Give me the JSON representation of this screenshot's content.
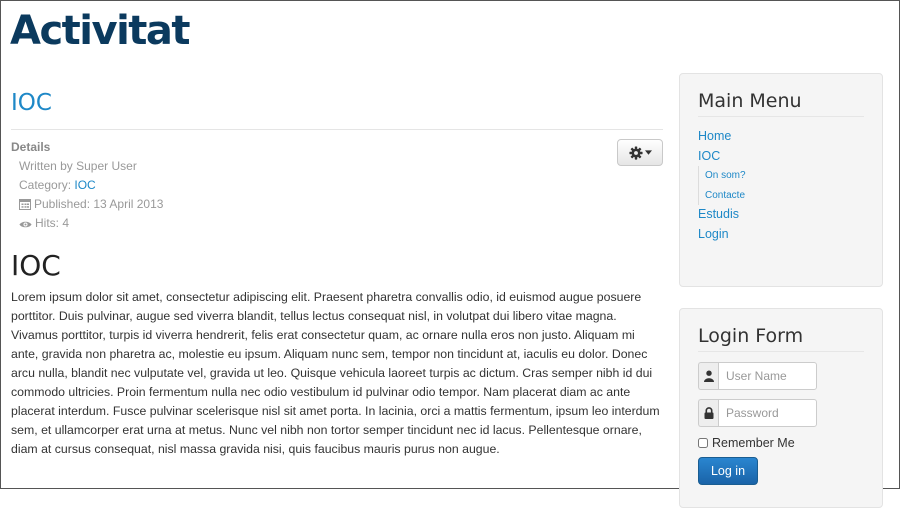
{
  "site": {
    "title": "Activitat"
  },
  "article": {
    "title": "IOC",
    "details": {
      "heading": "Details",
      "written_by": "Written by Super User",
      "category_label": "Category: ",
      "category_link": "IOC",
      "published": "Published: 13 April 2013",
      "hits": "Hits: 4"
    },
    "tools_icon": "gear-icon",
    "body_heading": "IOC",
    "body_text": "Lorem ipsum dolor sit amet, consectetur adipiscing elit. Praesent pharetra convallis odio, id euismod augue posuere porttitor. Duis pulvinar, augue sed viverra blandit, tellus lectus consequat nisl, in volutpat dui libero vitae magna. Vivamus porttitor, turpis id viverra hendrerit, felis erat consectetur quam, ac ornare nulla eros non justo. Aliquam mi ante, gravida non pharetra ac, molestie eu ipsum. Aliquam nunc sem, tempor non tincidunt at, iaculis eu dolor. Donec arcu nulla, blandit nec vulputate vel, gravida ut leo. Quisque vehicula laoreet turpis ac dictum. Cras semper nibh id dui commodo ultricies. Proin fermentum nulla nec odio vestibulum id pulvinar odio tempor. Nam placerat diam ac ante placerat interdum. Fusce pulvinar scelerisque nisl sit amet porta. In lacinia, orci a mattis fermentum, ipsum leo interdum sem, et ullamcorper erat urna at metus. Nunc vel nibh non tortor semper tincidunt nec id lacus. Pellentesque ornare, diam at cursus consequat, nisl massa gravida nisi, quis faucibus mauris purus non augue."
  },
  "main_menu": {
    "title": "Main Menu",
    "items": [
      "Home",
      "IOC",
      "Estudis",
      "Login"
    ],
    "subitems": [
      "On som?",
      "Contacte"
    ]
  },
  "login_form": {
    "title": "Login Form",
    "username_placeholder": "User Name",
    "password_placeholder": "Password",
    "remember_label": "Remember Me",
    "submit_label": "Log in"
  },
  "colors": {
    "site_title": "#0b3a5e",
    "link": "#1e88c7",
    "button": "#1a63a8"
  }
}
